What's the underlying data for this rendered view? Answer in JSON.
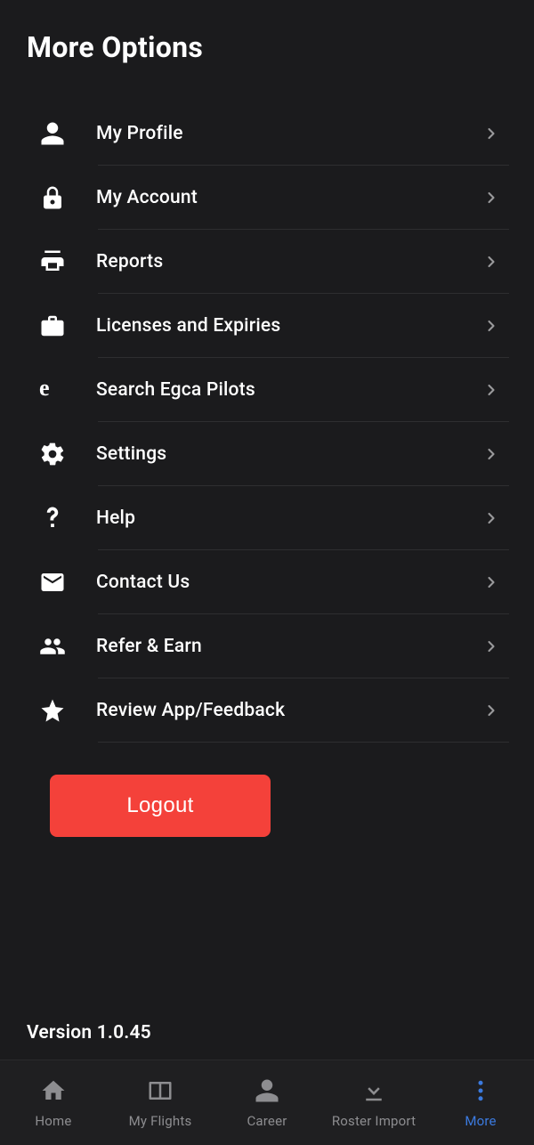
{
  "title": "More Options",
  "menu": [
    {
      "id": "profile",
      "label": "My Profile"
    },
    {
      "id": "account",
      "label": "My Account"
    },
    {
      "id": "reports",
      "label": "Reports"
    },
    {
      "id": "licenses",
      "label": "Licenses and Expiries"
    },
    {
      "id": "egca",
      "label": "Search Egca Pilots"
    },
    {
      "id": "settings",
      "label": "Settings"
    },
    {
      "id": "help",
      "label": "Help"
    },
    {
      "id": "contact",
      "label": "Contact Us"
    },
    {
      "id": "refer",
      "label": "Refer & Earn"
    },
    {
      "id": "review",
      "label": "Review App/Feedback"
    }
  ],
  "logout_label": "Logout",
  "version_text": "Version 1.0.45",
  "nav": {
    "home": {
      "label": "Home"
    },
    "flights": {
      "label": "My Flights"
    },
    "career": {
      "label": "Career"
    },
    "roster": {
      "label": "Roster Import"
    },
    "more": {
      "label": "More",
      "active": true
    }
  },
  "colors": {
    "bg": "#1b1b1d",
    "logout": "#f4413a",
    "accent": "#3b7adf"
  }
}
